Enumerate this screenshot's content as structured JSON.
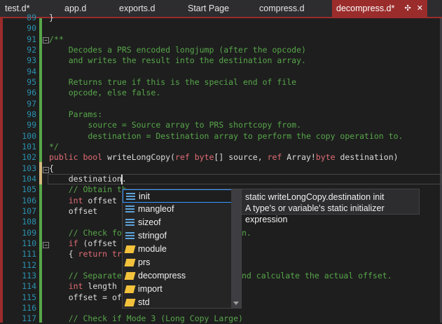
{
  "tabs": [
    {
      "label": "test.d*"
    },
    {
      "label": "app.d"
    },
    {
      "label": "exports.d"
    },
    {
      "label": "Start Page"
    },
    {
      "label": "compress.d"
    },
    {
      "label": "decompress.d*",
      "pin_icon": "✣",
      "close_icon": "✕"
    }
  ],
  "lines": [
    {
      "num": "89",
      "text": "}"
    },
    {
      "num": "90",
      "text": ""
    },
    {
      "num": "91",
      "text": "/**"
    },
    {
      "num": "92",
      "text": "    Decodes a PRS encoded longjump (after the opcode)"
    },
    {
      "num": "93",
      "text": "    and writes the result into the destination array."
    },
    {
      "num": "94",
      "text": ""
    },
    {
      "num": "95",
      "text": "    Returns true if this is the special end of file"
    },
    {
      "num": "96",
      "text": "    opcode, else false."
    },
    {
      "num": "97",
      "text": ""
    },
    {
      "num": "98",
      "text": "    Params:"
    },
    {
      "num": "99",
      "text": "        source = Source array to PRS shortcopy from."
    },
    {
      "num": "100",
      "text": "        destination = Destination array to perform the copy operation to."
    },
    {
      "num": "101",
      "text": "*/"
    },
    {
      "num": "102",
      "kw1": "public bool",
      "mid1": " writeLongCopy(",
      "kw2": "ref byte",
      "mid2": "[] source, ",
      "kw3": "ref",
      "mid3": " Array!",
      "kw4": "byte",
      "mid4": " destination)"
    },
    {
      "num": "103",
      "text": "{"
    },
    {
      "num": "104",
      "text": "    destination."
    },
    {
      "num": "105",
      "text": "    // Obtain th"
    },
    {
      "num": "106",
      "kw": "int",
      "text": " offset"
    },
    {
      "num": "107",
      "text": "    offset"
    },
    {
      "num": "108",
      "text": ""
    },
    {
      "num": "109",
      "text": "    // Check for",
      "tail": "n."
    },
    {
      "num": "110",
      "kw": "if",
      "text": " (offset ="
    },
    {
      "num": "111",
      "text": "    { ",
      "kw2": "return tru"
    },
    {
      "num": "112",
      "text": ""
    },
    {
      "num": "113",
      "text": "    // Separate",
      "tail": "nd calculate the actual offset."
    },
    {
      "num": "114",
      "kw": "int",
      "text": " length ="
    },
    {
      "num": "115",
      "text": "    offset = off"
    },
    {
      "num": "116",
      "text": ""
    },
    {
      "num": "117",
      "text": "    // Check if Mode 3 (Long Copy Large)"
    }
  ],
  "completion": {
    "items": [
      {
        "label": "init",
        "icon": "field-icon"
      },
      {
        "label": "mangleof",
        "icon": "field-icon"
      },
      {
        "label": "sizeof",
        "icon": "field-icon"
      },
      {
        "label": "stringof",
        "icon": "field-icon"
      },
      {
        "label": "module",
        "icon": "module-icon"
      },
      {
        "label": "prs",
        "icon": "module-icon"
      },
      {
        "label": "decompress",
        "icon": "module-icon"
      },
      {
        "label": "import",
        "icon": "module-icon"
      },
      {
        "label": "std",
        "icon": "module-icon"
      }
    ],
    "selected": "init"
  },
  "tooltip": {
    "line1": "static writeLongCopy.destination init",
    "line2": "A type's or variable's static initializer expression"
  }
}
